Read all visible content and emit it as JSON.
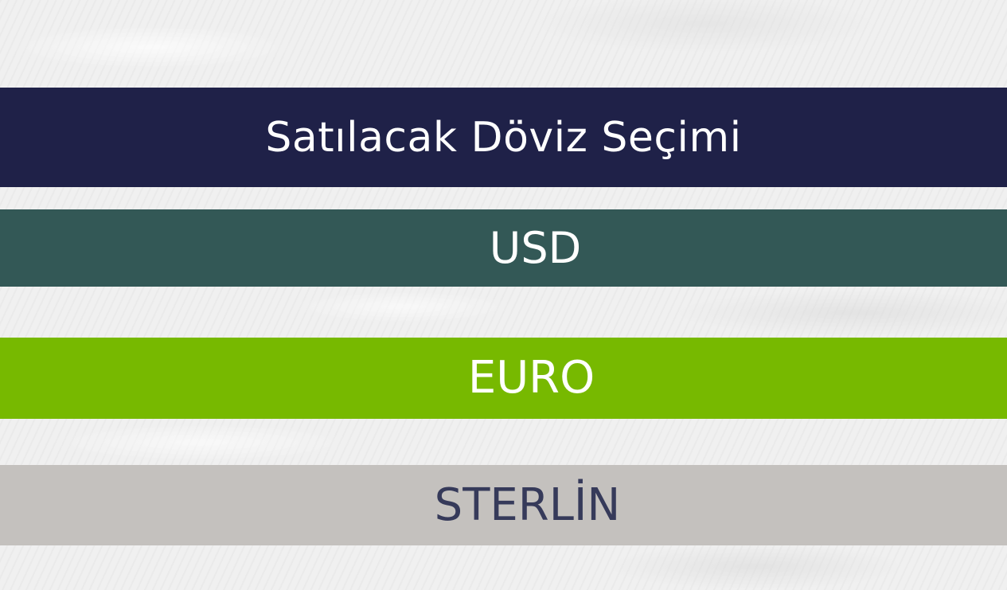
{
  "header": {
    "title": "Satılacak Döviz Seçimi"
  },
  "options": {
    "usd": {
      "label": "USD"
    },
    "euro": {
      "label": "EURO"
    },
    "sterlin": {
      "label": "STERLİN"
    }
  },
  "colors": {
    "title_band": "#1f2148",
    "usd_band": "#335856",
    "euro_band": "#77b900",
    "sterlin_band": "#c4c1be",
    "light_text": "#ffffff",
    "dark_text": "#363a5a"
  }
}
